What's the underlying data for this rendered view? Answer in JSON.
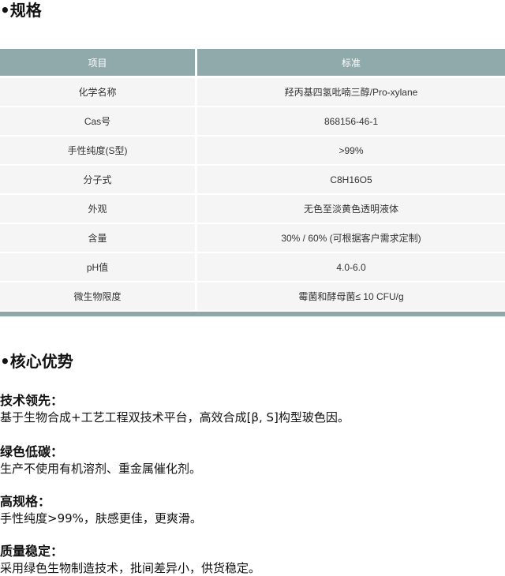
{
  "spec": {
    "title": "•规格",
    "header": {
      "col1": "项目",
      "col2": "标准"
    },
    "rows": [
      {
        "label": "化学名称",
        "value": "羟丙基四氢吡喃三醇/Pro-xylane"
      },
      {
        "label": "Cas号",
        "value": "868156-46-1"
      },
      {
        "label": "手性纯度(S型)",
        "value": ">99%"
      },
      {
        "label": "分子式",
        "value": "C8H16O5"
      },
      {
        "label": "外观",
        "value": "无色至淡黄色透明液体"
      },
      {
        "label": "含量",
        "value": "30% / 60% (可根据客户需求定制)"
      },
      {
        "label": "pH值",
        "value": "4.0-6.0"
      },
      {
        "label": "微生物限度",
        "value": "霉菌和酵母菌≤ 10 CFU/g"
      }
    ]
  },
  "advantages": {
    "title": "•核心优势",
    "items": [
      {
        "title": "技术领先：",
        "desc": "基于生物合成+工艺工程双技术平台，高效合成[β, S]构型玻色因。"
      },
      {
        "title": "绿色低碳：",
        "desc": "生产不使用有机溶剂、重金属催化剂。"
      },
      {
        "title": "高规格：",
        "desc": "手性纯度>99%，肤感更佳，更爽滑。"
      },
      {
        "title": "质量稳定：",
        "desc": "采用绿色生物制造技术，批间差异小，供货稳定。"
      }
    ]
  }
}
